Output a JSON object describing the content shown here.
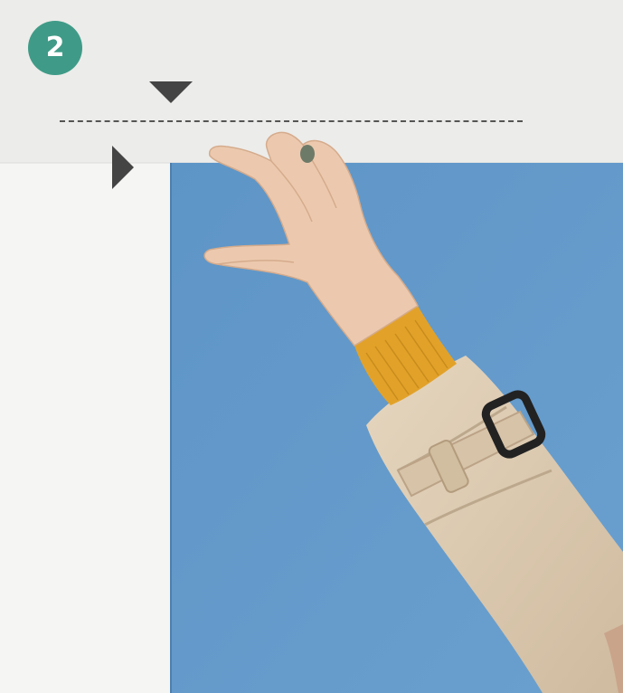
{
  "step": {
    "number": "2",
    "badge_color": "#3f9b87"
  },
  "colors": {
    "wall_upper": "#ececea",
    "wall_lower": "#f4f4f2",
    "panel_blue": "#5f96c8",
    "sleeve_beige": "#ddcbb3",
    "sweater_mustard": "#e0a12a",
    "skin": "#eac6ad",
    "marker": "#444444"
  },
  "icons": {
    "down_marker": "triangle-down-icon",
    "right_marker": "triangle-right-icon"
  }
}
